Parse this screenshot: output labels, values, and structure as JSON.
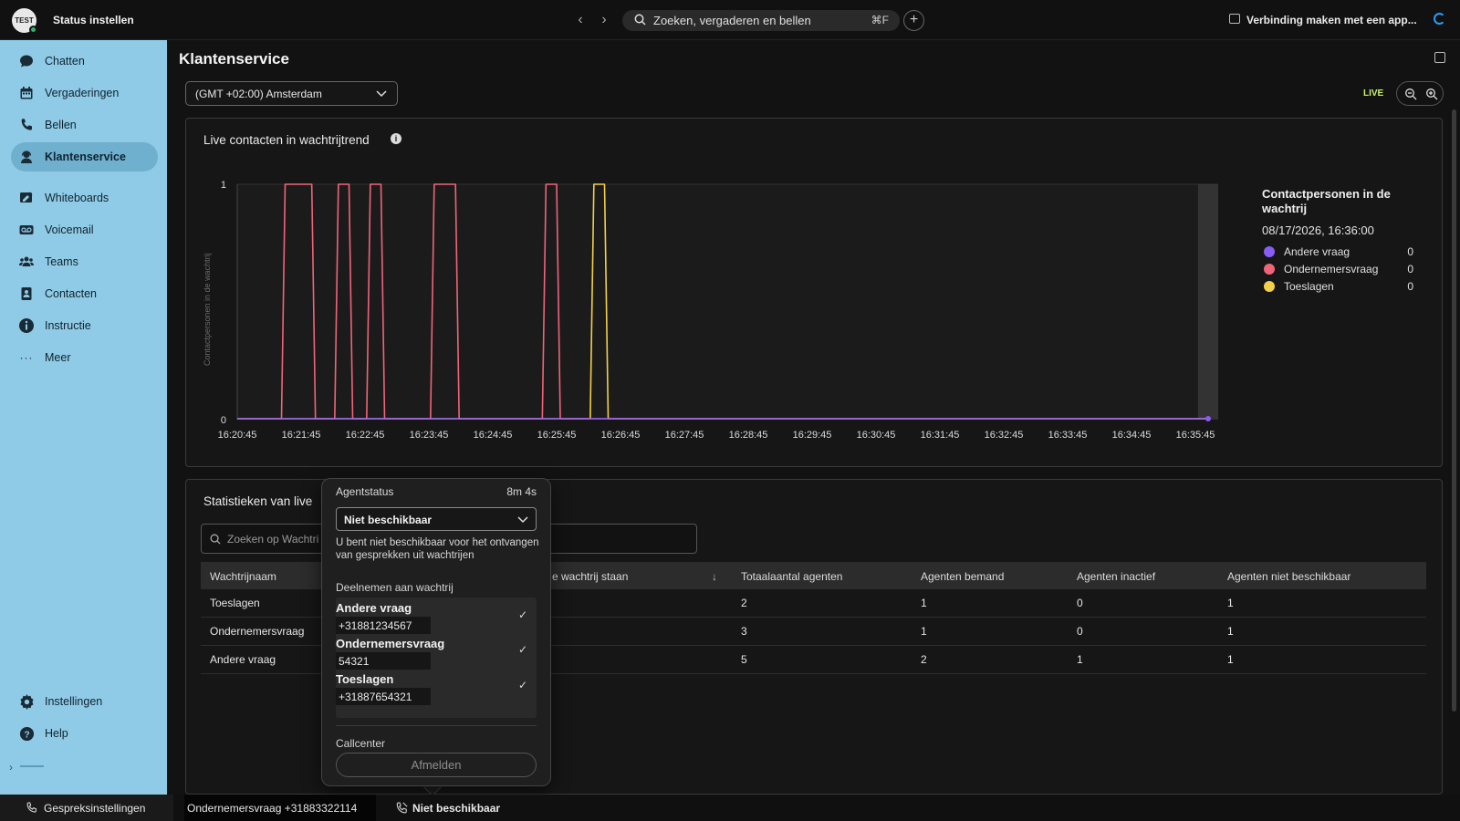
{
  "topbar": {
    "avatar_text": "TEST",
    "status_label": "Status instellen",
    "search_placeholder": "Zoeken, vergaderen en bellen",
    "search_shortcut": "⌘F",
    "connect_label": "Verbinding maken met een app..."
  },
  "sidebar": {
    "items": [
      {
        "label": "Chatten",
        "icon": "chat-icon"
      },
      {
        "label": "Vergaderingen",
        "icon": "calendar-icon"
      },
      {
        "label": "Bellen",
        "icon": "phone-icon"
      },
      {
        "label": "Klantenservice",
        "icon": "headset-icon",
        "active": true
      },
      {
        "label": "Whiteboards",
        "icon": "whiteboard-icon"
      },
      {
        "label": "Voicemail",
        "icon": "voicemail-icon"
      },
      {
        "label": "Teams",
        "icon": "teams-icon"
      },
      {
        "label": "Contacten",
        "icon": "contacts-icon"
      },
      {
        "label": "Instructie",
        "icon": "info-icon"
      },
      {
        "label": "Meer",
        "icon": "more-icon"
      }
    ],
    "bottom_items": [
      {
        "label": "Instellingen",
        "icon": "gear-icon"
      },
      {
        "label": "Help",
        "icon": "help-icon"
      }
    ]
  },
  "main": {
    "title": "Klantenservice",
    "timezone": "(GMT +02:00) Amsterdam",
    "live_label": "LIVE"
  },
  "trend_panel": {
    "title": "Live contacten in wachtrijtrend",
    "legend_title": "Contactpersonen in de wachtrij",
    "legend_date": "08/17/2026, 16:36:00",
    "legend": [
      {
        "name": "Andere vraag",
        "value": "0",
        "color": "#8a5cf6"
      },
      {
        "name": "Ondernemersvraag",
        "value": "0",
        "color": "#f0647a"
      },
      {
        "name": "Toeslagen",
        "value": "0",
        "color": "#f2d04a"
      }
    ]
  },
  "chart_data": {
    "type": "line",
    "title": "Live contacten in wachtrijtrend",
    "xlabel": "",
    "ylabel": "Contactpersonen in de wachtrij",
    "ylim": [
      0,
      1
    ],
    "yticks": [
      "0",
      "1"
    ],
    "x_ticks": [
      "16:20:45",
      "16:21:45",
      "16:22:45",
      "16:23:45",
      "16:24:45",
      "16:25:45",
      "16:26:45",
      "16:27:45",
      "16:28:45",
      "16:29:45",
      "16:30:45",
      "16:31:45",
      "16:32:45",
      "16:33:45",
      "16:34:45",
      "16:35:45"
    ],
    "series": [
      {
        "name": "Ondernemersvraag",
        "color": "#f0647a",
        "pulses": [
          [
            "16:21:30",
            "16:21:55"
          ],
          [
            "16:22:20",
            "16:22:30"
          ],
          [
            "16:22:50",
            "16:23:00"
          ],
          [
            "16:23:50",
            "16:24:10"
          ],
          [
            "16:25:35",
            "16:25:45"
          ]
        ]
      },
      {
        "name": "Toeslagen",
        "color": "#f2d04a",
        "pulses": [
          [
            "16:26:20",
            "16:26:30"
          ]
        ]
      },
      {
        "name": "Andere vraag",
        "color": "#8a5cf6",
        "pulses": []
      }
    ]
  },
  "stats_panel": {
    "title": "Statistieken van live",
    "search_placeholder": "Zoeken op Wachtri",
    "columns": [
      "Wachtrijnaam",
      "e wachtrij staan",
      "Totaalaantal agenten",
      "Agenten bemand",
      "Agenten inactief",
      "Agenten niet beschikbaar"
    ],
    "rows": [
      [
        "Toeslagen",
        "",
        "2",
        "1",
        "0",
        "1"
      ],
      [
        "Ondernemersvraag",
        "",
        "3",
        "1",
        "0",
        "1"
      ],
      [
        "Andere vraag",
        "",
        "5",
        "2",
        "1",
        "1"
      ]
    ]
  },
  "popover": {
    "title": "Agentstatus",
    "timer": "8m 4s",
    "status_value": "Niet beschikbaar",
    "status_note": "U bent niet beschikbaar voor het ontvangen van gesprekken uit wachtrijen",
    "join_label": "Deelnemen aan wachtrij",
    "queues": [
      {
        "name": "Andere vraag",
        "number": "+31881234567",
        "checked": true
      },
      {
        "name": "Ondernemersvraag",
        "number": "54321",
        "checked": true
      },
      {
        "name": "Toeslagen",
        "number": "+31887654321",
        "checked": true
      }
    ],
    "callcenter_label": "Callcenter",
    "logout_label": "Afmelden"
  },
  "bottombar": {
    "call_settings": "Gespreksinstellingen",
    "queue_number": "Ondernemersvraag +31883322114",
    "agent_status": "Niet beschikbaar"
  }
}
